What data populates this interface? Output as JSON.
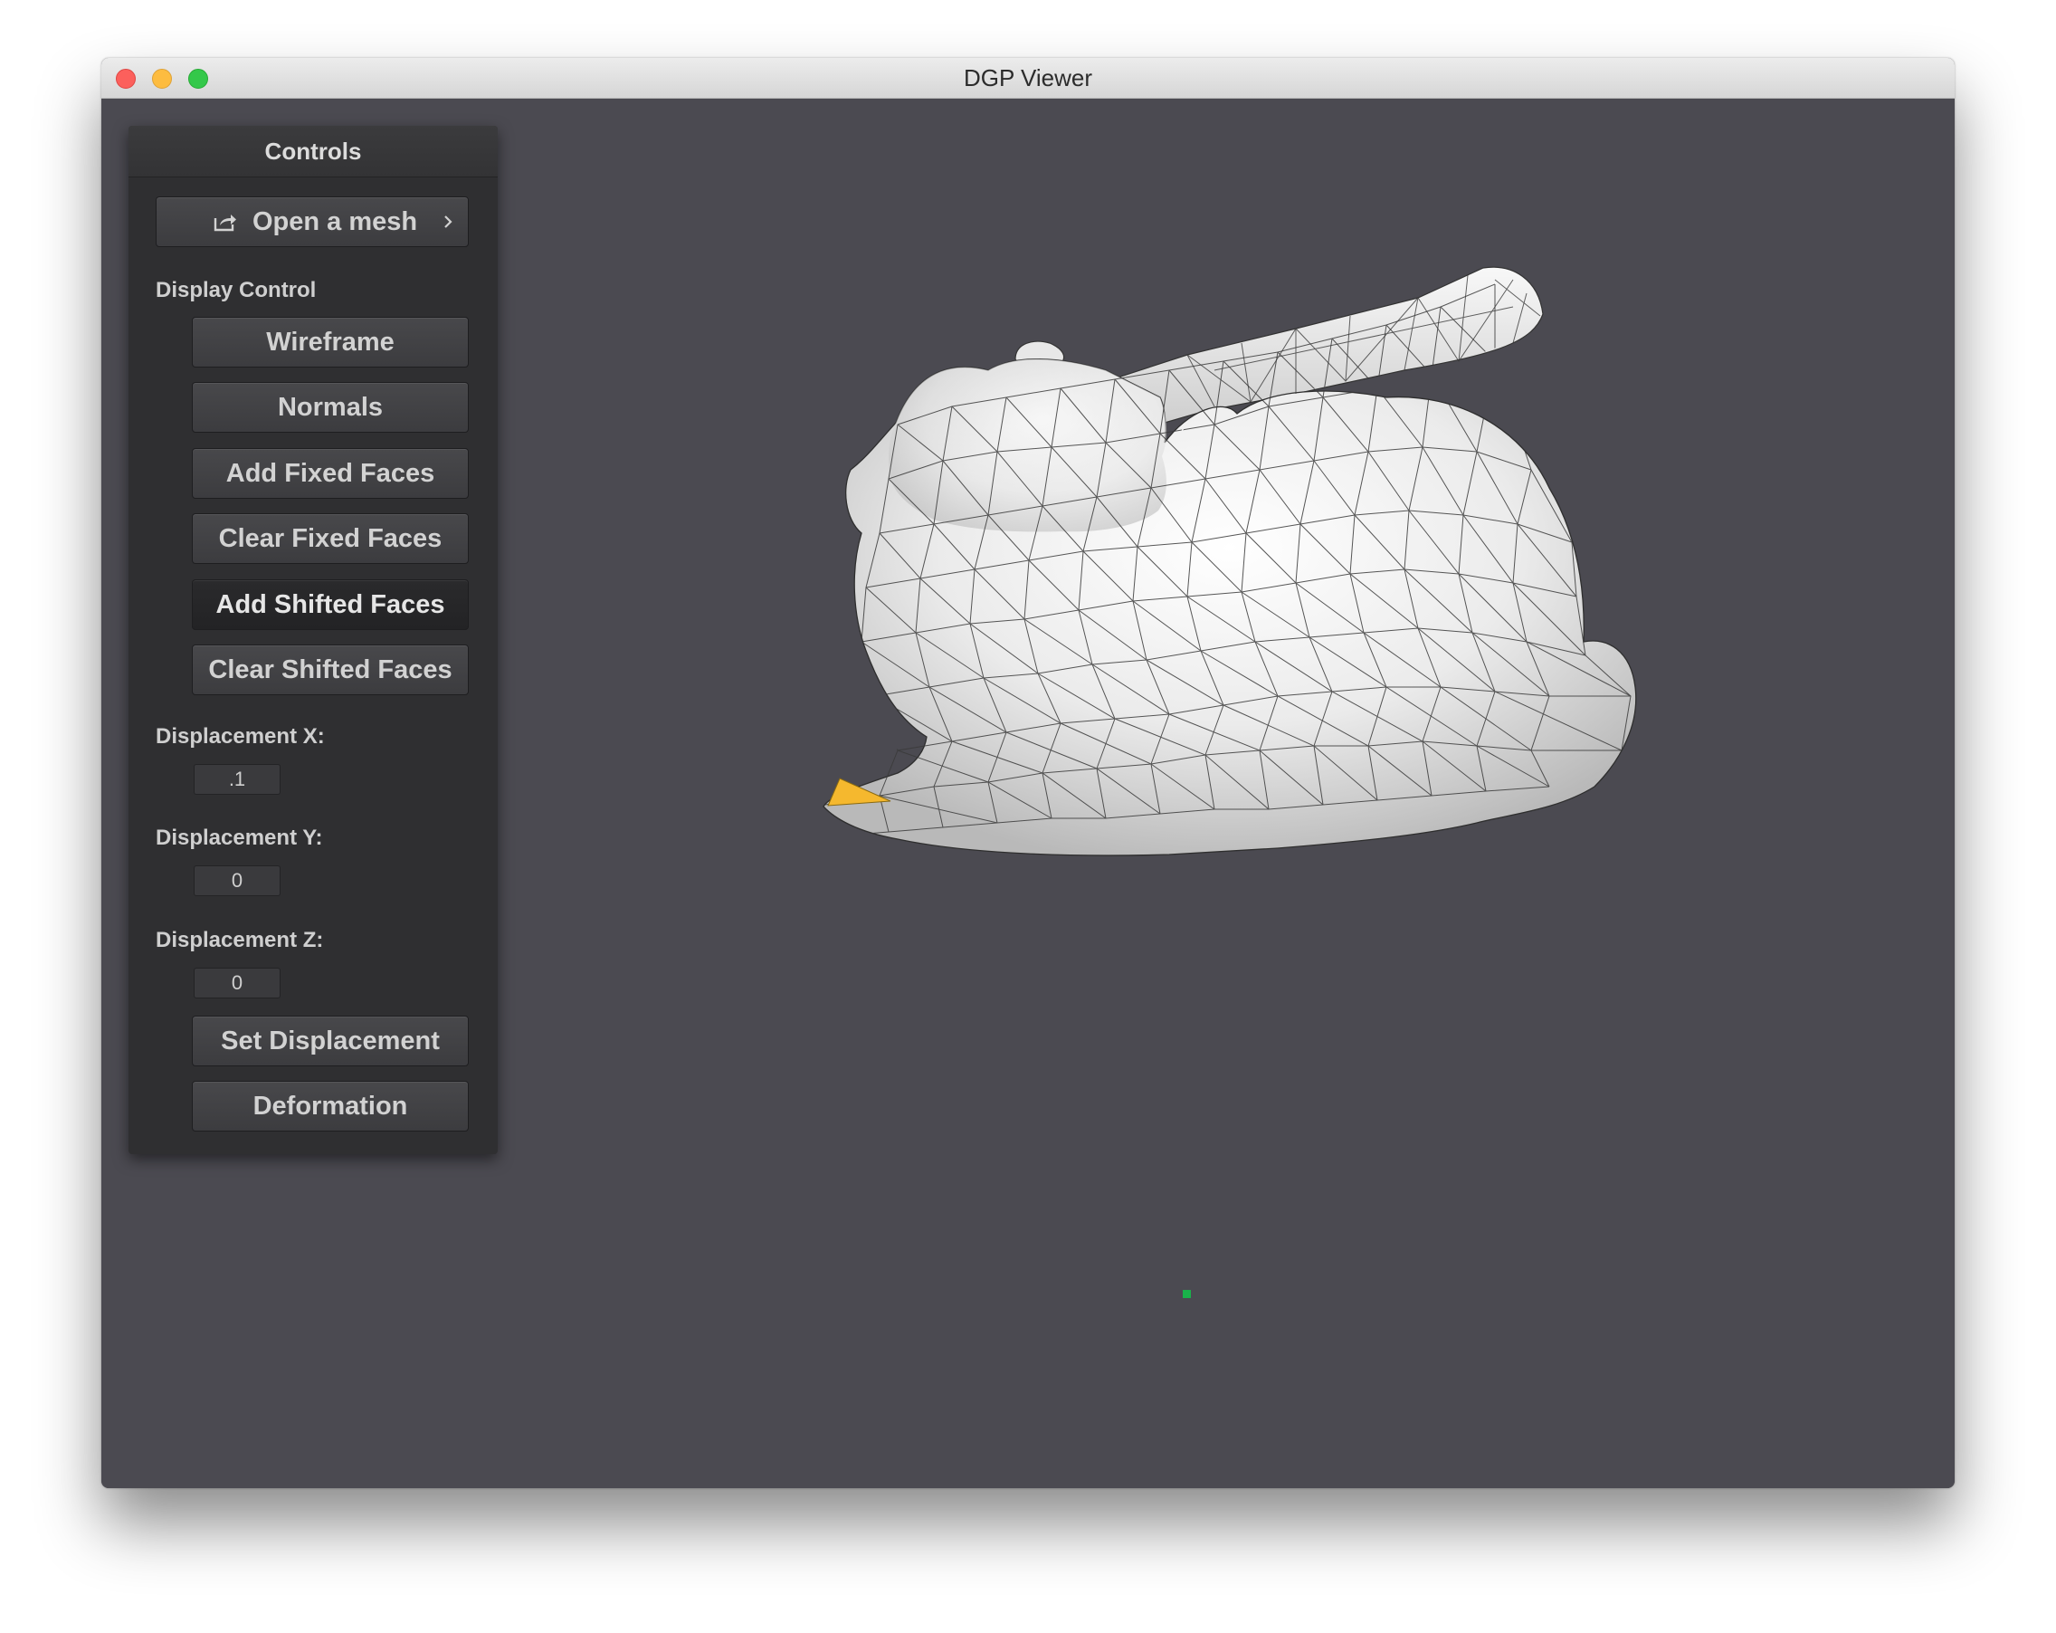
{
  "window": {
    "title": "DGP Viewer"
  },
  "panel": {
    "title": "Controls",
    "open_button": {
      "label": "Open a mesh",
      "icon": "share-icon",
      "trailing_icon": "chevron-right-icon"
    },
    "display_control_label": "Display Control",
    "buttons": [
      {
        "label": "Wireframe"
      },
      {
        "label": "Normals"
      },
      {
        "label": "Add Fixed Faces"
      },
      {
        "label": "Clear Fixed Faces"
      },
      {
        "label": "Add Shifted Faces",
        "active": true
      },
      {
        "label": "Clear Shifted Faces"
      }
    ],
    "displacement": [
      {
        "label": "Displacement X:",
        "value": ".1"
      },
      {
        "label": "Displacement Y:",
        "value": "0"
      },
      {
        "label": "Displacement Z:",
        "value": "0"
      }
    ],
    "set_displacement_label": "Set Displacement",
    "deformation_label": "Deformation"
  },
  "viewport": {
    "background": "#4b4a51",
    "mesh_color": "#f2f2f2",
    "selected_face_color": "#f5b82e",
    "marker_color": "#19b24a"
  }
}
